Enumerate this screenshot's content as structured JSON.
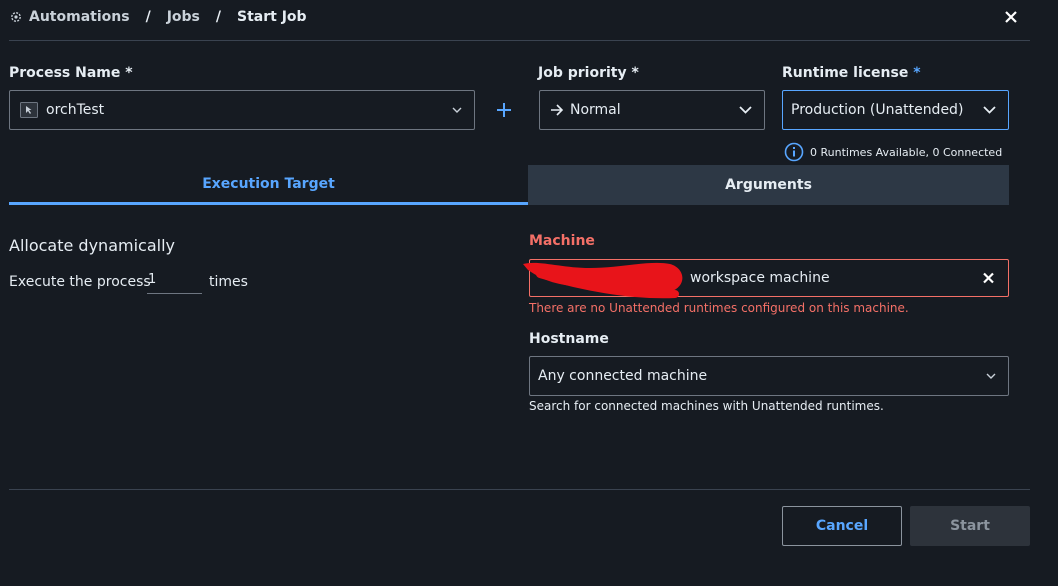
{
  "breadcrumb": {
    "automations": "Automations",
    "jobs": "Jobs",
    "start_job": "Start Job",
    "separator": "/"
  },
  "process": {
    "label": "Process Name *",
    "value": "orchTest"
  },
  "priority": {
    "label": "Job priority *",
    "value": "Normal"
  },
  "runtime_license": {
    "label": "Runtime license",
    "required_mark": "*",
    "value": "Production (Unattended)",
    "info": "0 Runtimes Available, 0 Connected"
  },
  "tabs": {
    "execution_target": "Execution Target",
    "arguments": "Arguments"
  },
  "allocation": {
    "title": "Allocate dynamically",
    "execute_prefix": "Execute the process",
    "count": "1",
    "execute_suffix": "times"
  },
  "machine": {
    "label": "Machine",
    "value": "workspace machine",
    "error": "There are no Unattended runtimes configured on this machine."
  },
  "hostname": {
    "label": "Hostname",
    "value": "Any connected machine",
    "help": "Search for connected machines with Unattended runtimes."
  },
  "buttons": {
    "cancel": "Cancel",
    "start": "Start"
  },
  "colors": {
    "accent": "#58a6ff",
    "error": "#f47067",
    "background": "#161b22",
    "tab_inactive": "#2d3845"
  },
  "icons": [
    "gear-icon",
    "close-icon",
    "process-icon",
    "chevron-down-icon",
    "plus-icon",
    "arrow-right-icon",
    "info-icon",
    "clear-icon"
  ]
}
